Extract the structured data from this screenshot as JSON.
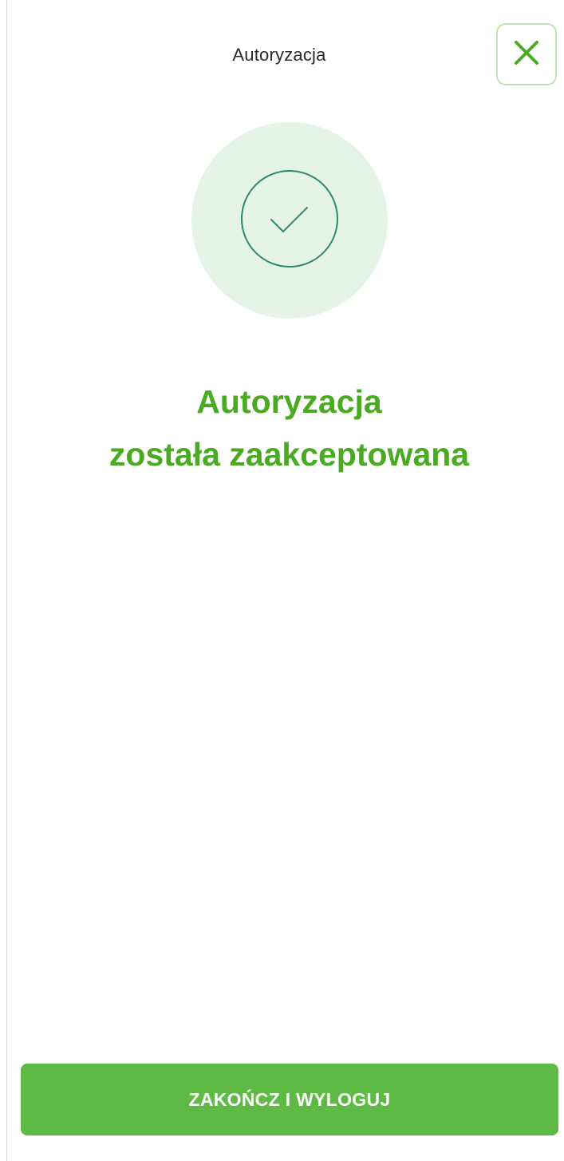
{
  "header": {
    "title": "Autoryzacja",
    "close_icon": "close-icon"
  },
  "status": {
    "icon": "checkmark-icon",
    "line1": "Autoryzacja",
    "line2": "została zaakceptowana"
  },
  "footer": {
    "button_label": "ZAKOŃCZ I WYLOGUJ"
  },
  "colors": {
    "accent_green": "#5fba45",
    "headline_green": "#4aaa22",
    "bubble_bg": "#e6f4e8",
    "check_ring": "#2f8a5e"
  }
}
